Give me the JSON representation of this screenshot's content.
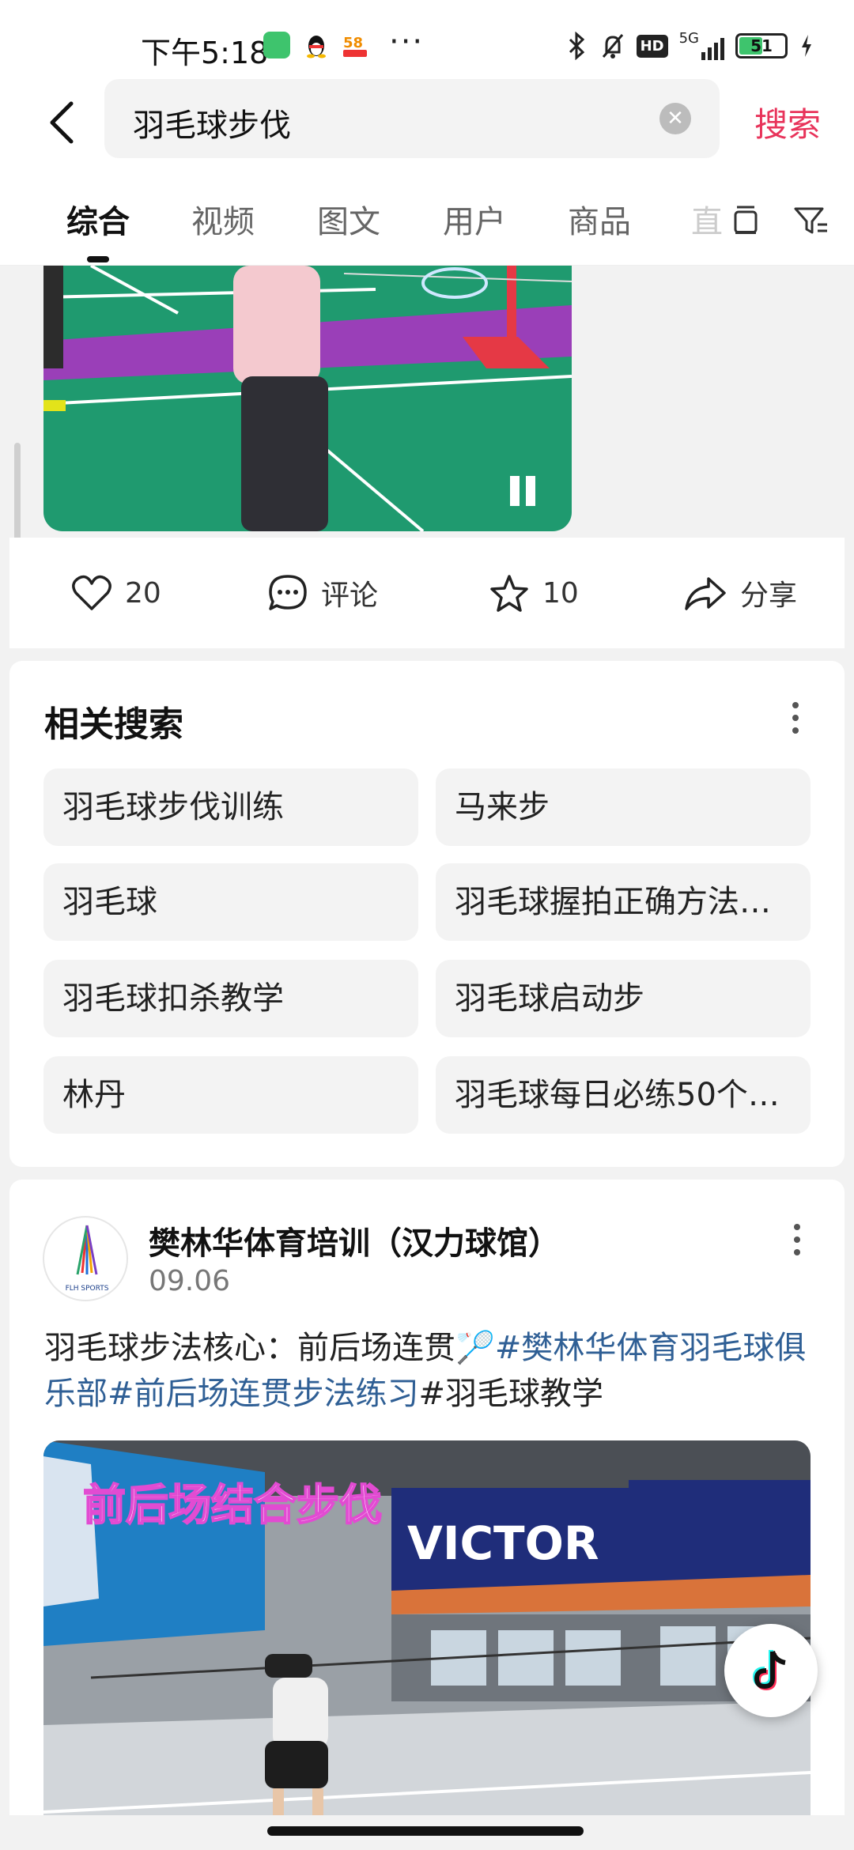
{
  "status_bar": {
    "time": "下午5:18",
    "network": "5G",
    "battery": "51",
    "battery_level": 0.51,
    "icons": [
      "wechat-icon",
      "qq-icon",
      "58-app-icon",
      "bluetooth-icon",
      "mute-icon",
      "hd-icon",
      "signal-icon",
      "battery-icon",
      "charging-icon"
    ],
    "hd_label": "HD"
  },
  "header": {
    "search_query": "羽毛球步伐",
    "search_button": "搜索"
  },
  "tabs": {
    "items": [
      {
        "label": "综合",
        "active": true
      },
      {
        "label": "视频",
        "active": false
      },
      {
        "label": "图文",
        "active": false
      },
      {
        "label": "用户",
        "active": false
      },
      {
        "label": "商品",
        "active": false
      }
    ],
    "overflow_label": "直"
  },
  "top_video": {
    "actions": {
      "likes": "20",
      "comment_label": "评论",
      "favorites": "10",
      "share_label": "分享"
    }
  },
  "related_search": {
    "title": "相关搜索",
    "items": [
      "羽毛球步伐训练",
      "马来步",
      "羽毛球",
      "羽毛球握拍正确方法…",
      "羽毛球扣杀教学",
      "羽毛球启动步",
      "林丹",
      "羽毛球每日必练50个…"
    ]
  },
  "post": {
    "author": "樊林华体育培训（汉力球馆）",
    "date": "09.06",
    "avatar_text": "FLH SPORTS",
    "desc_plain": "羽毛球步法核心：前后场连贯🏸",
    "tag1": "#樊林华体育羽毛球俱乐部",
    "tag2": "#前后场连贯步法练习",
    "tag3": "#羽毛球教学",
    "video_overlay_title": "前后场结合步伐",
    "banner_text": "VICTOR"
  },
  "colors": {
    "accent": "#e8335a",
    "tag": "#2f5f95",
    "court_green": "#1f9a6f",
    "court_purple": "#9a3fb8"
  }
}
